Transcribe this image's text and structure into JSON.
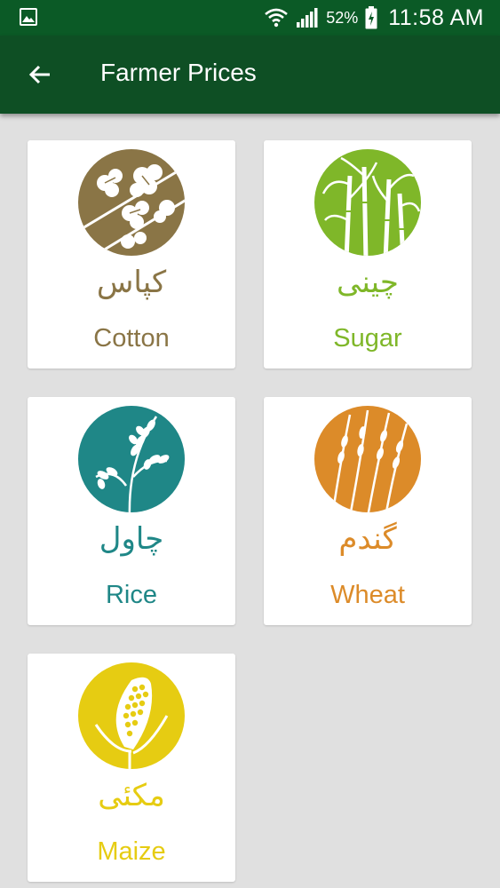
{
  "status_bar": {
    "battery_percent": "52%",
    "time": "11:58 AM",
    "icons": [
      "gallery-icon",
      "wifi-icon",
      "signal-icon",
      "battery-icon"
    ]
  },
  "app_bar": {
    "title": "Farmer Prices",
    "back_icon": "arrow-back-icon"
  },
  "crops": [
    {
      "urdu": "کپاس",
      "label": "Cotton",
      "color": "#8a7546",
      "icon": "cotton-icon"
    },
    {
      "urdu": "چینی",
      "label": "Sugar",
      "color": "#7fb729",
      "icon": "sugarcane-icon"
    },
    {
      "urdu": "چاول",
      "label": "Rice",
      "color": "#1f8787",
      "icon": "rice-icon"
    },
    {
      "urdu": "گندم",
      "label": "Wheat",
      "color": "#dc8b29",
      "icon": "wheat-icon"
    },
    {
      "urdu": "مکئی",
      "label": "Maize",
      "color": "#e6cc12",
      "icon": "maize-icon"
    }
  ]
}
